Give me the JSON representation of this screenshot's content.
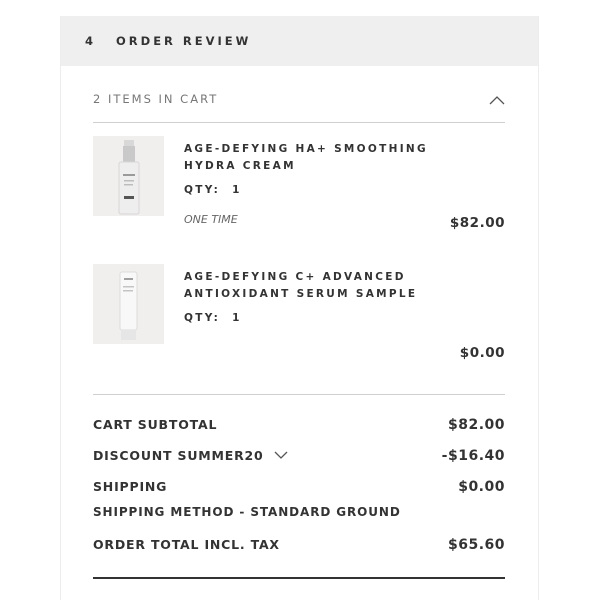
{
  "header": {
    "step_number": "4",
    "title": "ORDER REVIEW"
  },
  "cart": {
    "items_label": "2 ITEMS IN CART",
    "items": [
      {
        "name": "AGE-DEFYING HA+ SMOOTHING HYDRA CREAM",
        "qty_label": "QTY:",
        "qty": "1",
        "frequency": "ONE TIME",
        "price": "$82.00",
        "image_icon": "cream-pump-bottle-icon"
      },
      {
        "name": "AGE-DEFYING C+ ADVANCED ANTIOXIDANT SERUM SAMPLE",
        "qty_label": "QTY:",
        "qty": "1",
        "price": "$0.00",
        "image_icon": "serum-tube-icon"
      }
    ]
  },
  "summary": {
    "subtotal_label": "CART SUBTOTAL",
    "subtotal_value": "$82.00",
    "discount_label": "DISCOUNT SUMMER20",
    "discount_value": "-$16.40",
    "shipping_label": "SHIPPING",
    "shipping_value": "$0.00",
    "shipping_method": "SHIPPING METHOD - STANDARD GROUND",
    "total_label": "ORDER TOTAL INCL. TAX",
    "total_value": "$65.60"
  }
}
